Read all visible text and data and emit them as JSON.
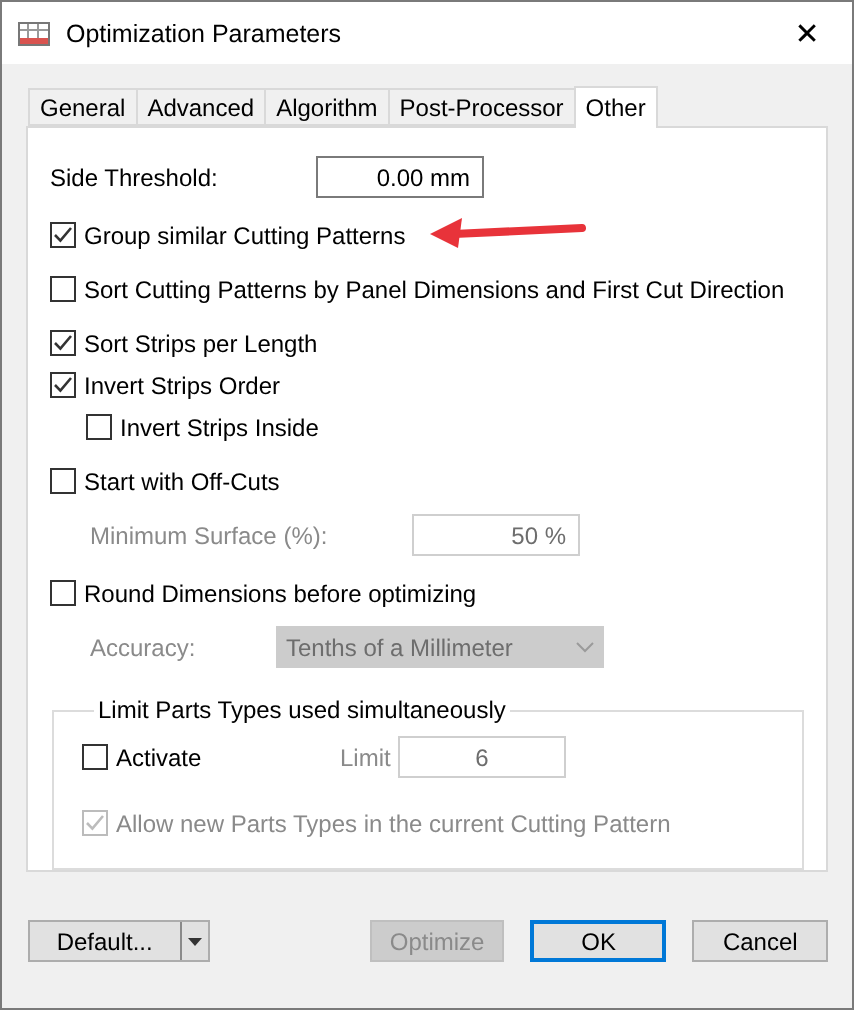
{
  "window": {
    "title": "Optimization Parameters",
    "close": "✕"
  },
  "tabs": [
    {
      "label": "General",
      "selected": false
    },
    {
      "label": "Advanced",
      "selected": false
    },
    {
      "label": "Algorithm",
      "selected": false
    },
    {
      "label": "Post-Processor",
      "selected": false
    },
    {
      "label": "Other",
      "selected": true
    }
  ],
  "sections": [
    [
      {
        "kind": "field",
        "label": "Side Threshold:",
        "value": "0.00 mm",
        "disabled": false
      }
    ],
    [
      {
        "kind": "checkbox",
        "label": "Group similar Cutting Patterns",
        "checked": true,
        "disabled": false
      }
    ],
    [
      {
        "kind": "checkbox",
        "label": "Sort Cutting Patterns by Panel Dimensions and First Cut Direction",
        "checked": false,
        "disabled": false
      }
    ],
    [
      {
        "kind": "checkbox",
        "label": "Sort Strips per Length",
        "checked": true,
        "disabled": false
      },
      {
        "kind": "checkbox",
        "label": "Invert Strips Order",
        "checked": true,
        "disabled": false,
        "children": [
          {
            "kind": "checkbox",
            "label": "Invert Strips Inside",
            "checked": false,
            "disabled": false
          }
        ]
      }
    ],
    [
      {
        "kind": "checkbox",
        "label": "Start with Off-Cuts",
        "checked": false,
        "disabled": false,
        "children": [
          {
            "kind": "field",
            "label": "Minimum Surface (%):",
            "value": "50 %",
            "disabled": true
          }
        ]
      }
    ],
    [
      {
        "kind": "checkbox",
        "label": "Round Dimensions before optimizing",
        "checked": false,
        "disabled": false,
        "children": [
          {
            "kind": "dropdown",
            "label": "Accuracy:",
            "value": "Tenths of a Millimeter",
            "disabled": true
          }
        ]
      }
    ]
  ],
  "group": {
    "title": "Limit Parts Types used simultaneously",
    "activate": {
      "label": "Activate",
      "checked": false,
      "disabled": false
    },
    "limit": {
      "label": "Limit",
      "value": "6",
      "disabled": true
    },
    "allow": {
      "label": "Allow new Parts Types in the current Cutting Pattern",
      "checked": true,
      "disabled": true
    }
  },
  "buttons": [
    {
      "kind": "split",
      "label": "Default...",
      "disabled": false,
      "default": false
    },
    {
      "kind": "push",
      "label": "Optimize",
      "disabled": true,
      "default": false
    },
    {
      "kind": "push",
      "label": "OK",
      "disabled": false,
      "default": true
    },
    {
      "kind": "push",
      "label": "Cancel",
      "disabled": false,
      "default": false
    }
  ]
}
